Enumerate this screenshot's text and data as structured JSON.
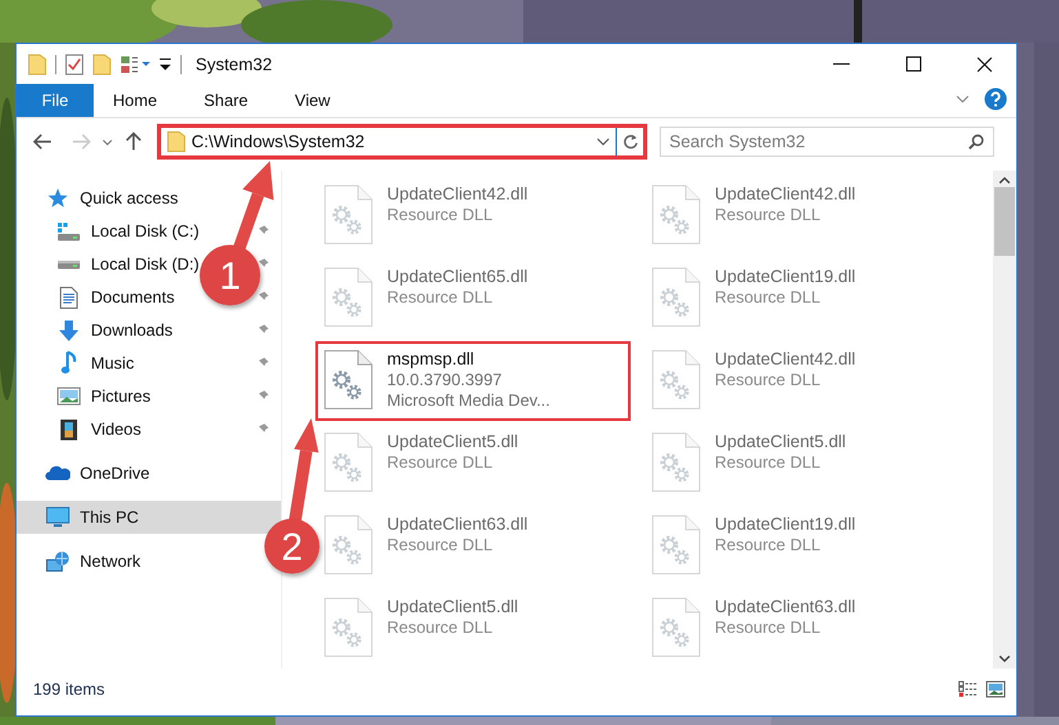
{
  "window": {
    "title": "System32"
  },
  "ribbon_tabs": [
    {
      "label": "File",
      "kind": "file"
    },
    {
      "label": "Home",
      "kind": "tab"
    },
    {
      "label": "Share",
      "kind": "tab"
    },
    {
      "label": "View",
      "kind": "tab"
    }
  ],
  "address_bar": {
    "path": "C:\\Windows\\System32",
    "highlighted": true
  },
  "search": {
    "placeholder": "Search System32"
  },
  "sidebar": {
    "items": [
      {
        "label": "Quick access",
        "selected": false,
        "children": [
          {
            "label": "Local Disk (C:)",
            "pinned": true
          },
          {
            "label": "Local Disk (D:)",
            "pinned": true
          },
          {
            "label": "Documents",
            "pinned": true
          },
          {
            "label": "Downloads",
            "pinned": true
          },
          {
            "label": "Music",
            "pinned": true
          },
          {
            "label": "Pictures",
            "pinned": true
          },
          {
            "label": "Videos",
            "pinned": true
          }
        ]
      },
      {
        "label": "OneDrive",
        "selected": false
      },
      {
        "label": "This PC",
        "selected": true
      },
      {
        "label": "Network",
        "selected": false
      }
    ]
  },
  "files": [
    {
      "name": "UpdateClient42.dll",
      "details": [
        "Resource DLL"
      ],
      "blurred": true,
      "highlighted": false
    },
    {
      "name": "UpdateClient42.dll",
      "details": [
        "Resource DLL"
      ],
      "blurred": true,
      "highlighted": false
    },
    {
      "name": "UpdateClient65.dll",
      "details": [
        "Resource DLL"
      ],
      "blurred": true,
      "highlighted": false
    },
    {
      "name": "UpdateClient19.dll",
      "details": [
        "Resource DLL"
      ],
      "blurred": true,
      "highlighted": false
    },
    {
      "name": "mspmsp.dll",
      "details": [
        "10.0.3790.3997",
        "Microsoft Media Dev..."
      ],
      "blurred": false,
      "highlighted": true
    },
    {
      "name": "UpdateClient42.dll",
      "details": [
        "Resource DLL"
      ],
      "blurred": true,
      "highlighted": false
    },
    {
      "name": "UpdateClient5.dll",
      "details": [
        "Resource DLL"
      ],
      "blurred": true,
      "highlighted": false
    },
    {
      "name": "UpdateClient5.dll",
      "details": [
        "Resource DLL"
      ],
      "blurred": true,
      "highlighted": false
    },
    {
      "name": "UpdateClient63.dll",
      "details": [
        "Resource DLL"
      ],
      "blurred": true,
      "highlighted": false
    },
    {
      "name": "UpdateClient19.dll",
      "details": [
        "Resource DLL"
      ],
      "blurred": true,
      "highlighted": false
    },
    {
      "name": "UpdateClient5.dll",
      "details": [
        "Resource DLL"
      ],
      "blurred": true,
      "highlighted": false
    },
    {
      "name": "UpdateClient63.dll",
      "details": [
        "Resource DLL"
      ],
      "blurred": true,
      "highlighted": false
    }
  ],
  "status_bar": {
    "item_count": "199 items"
  },
  "callouts": [
    {
      "number": "1"
    },
    {
      "number": "2"
    }
  ]
}
